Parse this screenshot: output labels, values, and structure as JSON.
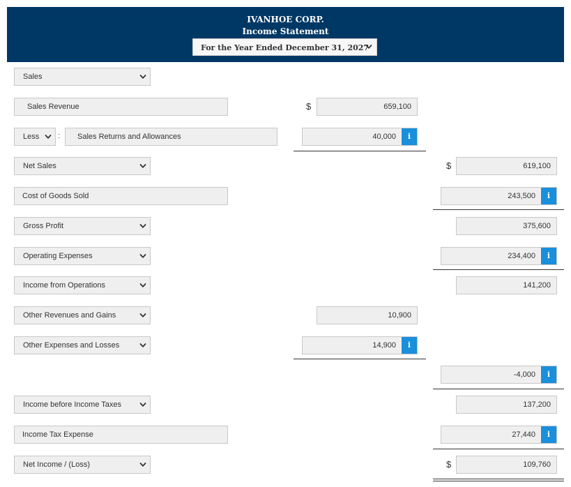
{
  "header": {
    "company": "IVANHOE CORP.",
    "title": "Income Statement",
    "period": "For the Year Ended December 31, 2027"
  },
  "rows": {
    "sales": "Sales",
    "sales_revenue": "Sales Revenue",
    "less": "Less",
    "colon": ":",
    "sales_returns": "Sales Returns and Allowances",
    "net_sales": "Net Sales",
    "cogs": "Cost of Goods Sold",
    "gross_profit": "Gross Profit",
    "operating_expenses": "Operating Expenses",
    "income_from_operations": "Income from Operations",
    "other_revenues": "Other Revenues and Gains",
    "other_expenses": "Other Expenses and Losses",
    "income_before_taxes": "Income before Income Taxes",
    "income_tax_expense": "Income Tax Expense",
    "net_income": "Net Income / (Loss)"
  },
  "values": {
    "sales_revenue": "659,100",
    "sales_returns": "40,000",
    "net_sales": "619,100",
    "cogs": "243,500",
    "gross_profit": "375,600",
    "operating_expenses": "234,400",
    "income_from_operations": "141,200",
    "other_revenues": "10,900",
    "other_expenses": "14,900",
    "other_net": "-4,000",
    "income_before_taxes": "137,200",
    "income_tax_expense": "27,440",
    "net_income": "109,760"
  },
  "symbols": {
    "dollar": "$",
    "info": "i"
  },
  "colors": {
    "header_bg": "#003865",
    "info_bg": "#1a8fdb",
    "field_bg": "#efefef"
  }
}
